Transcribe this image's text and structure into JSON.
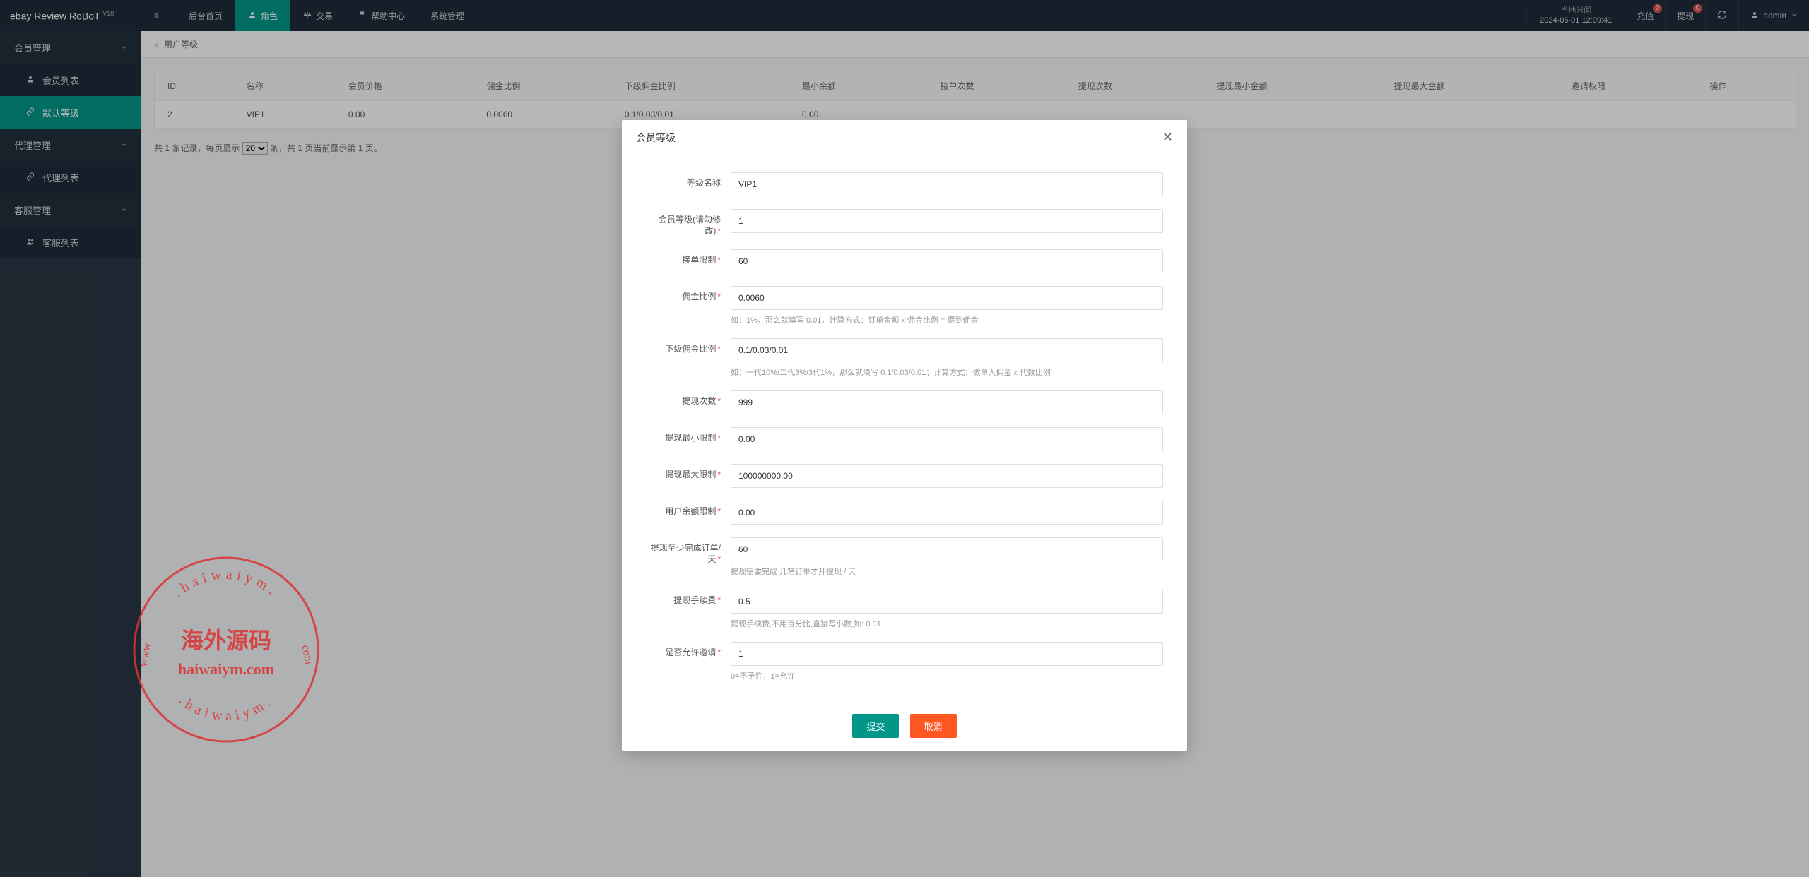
{
  "app": {
    "name": "ebay Review RoBoT",
    "version": "V18"
  },
  "top_nav": {
    "menu_icon": "≡",
    "items": [
      {
        "label": "后台首页",
        "icon": ""
      },
      {
        "label": "角色",
        "icon": "person",
        "active": true
      },
      {
        "label": "交易",
        "icon": "scale"
      },
      {
        "label": "帮助中心",
        "icon": "flag"
      },
      {
        "label": "系统管理",
        "icon": ""
      }
    ]
  },
  "header_right": {
    "time_label": "当地时间",
    "time_value": "2024-06-01 12:09:41",
    "recharge": {
      "label": "充值",
      "badge": "0"
    },
    "withdraw": {
      "label": "提现",
      "badge": "0"
    },
    "refresh_icon": "refresh",
    "user": {
      "icon": "person",
      "name": "admin",
      "caret": "chevron"
    }
  },
  "sidebar": {
    "groups": [
      {
        "label": "会员管理",
        "expanded": true,
        "items": [
          {
            "label": "会员列表",
            "icon": "person",
            "active": false
          },
          {
            "label": "默认等级",
            "icon": "link",
            "active": true
          }
        ]
      },
      {
        "label": "代理管理",
        "expanded": true,
        "items": [
          {
            "label": "代理列表",
            "icon": "link",
            "active": false
          }
        ]
      },
      {
        "label": "客服管理",
        "expanded": true,
        "items": [
          {
            "label": "客服列表",
            "icon": "people",
            "active": false
          }
        ]
      }
    ]
  },
  "breadcrumb": {
    "sep": "»",
    "current": "用户等级"
  },
  "table": {
    "headers": [
      "ID",
      "名称",
      "会员价格",
      "佣金比例",
      "下级佣金比例",
      "最小余额",
      "接单次数",
      "提现次数",
      "提现最小金额",
      "提现最大金额",
      "邀请权限",
      "操作"
    ],
    "rows": [
      {
        "id": "2",
        "name": "VIP1",
        "price": "0.00",
        "rate": "0.0060",
        "sub_rate": "0.1/0.03/0.01",
        "min_bal": "0.00"
      }
    ]
  },
  "pager": {
    "prefix": "共 1 条记录，每页显示",
    "suffix": "条，共 1 页当前显示第 1 页。",
    "page_size": "20"
  },
  "modal": {
    "title": "会员等级",
    "fields": {
      "level_name": {
        "label": "等级名称",
        "value": "VIP1",
        "required": false
      },
      "level_no": {
        "label": "会员等级(请勿修改)",
        "value": "1",
        "required": true
      },
      "order_limit": {
        "label": "接单限制",
        "value": "60",
        "required": true
      },
      "commission": {
        "label": "佣金比例",
        "value": "0.0060",
        "required": true,
        "hint": "如：1%，那么就填写 0.01，计算方式：订单金额 x 佣金比例 = 得到佣金"
      },
      "sub_commission": {
        "label": "下级佣金比例",
        "value": "0.1/0.03/0.01",
        "required": true,
        "hint": "如：一代10%/二代3%/3代1%，那么就填写 0.1/0.03/0.01；计算方式：做单人佣金 x 代数比例"
      },
      "withdraw_times": {
        "label": "提现次数",
        "value": "999",
        "required": true
      },
      "withdraw_min": {
        "label": "提现最小限制",
        "value": "0.00",
        "required": true
      },
      "withdraw_max": {
        "label": "提现最大限制",
        "value": "100000000.00",
        "required": true
      },
      "balance_limit": {
        "label": "用户余额限制",
        "value": "0.00",
        "required": true
      },
      "orders_per_day": {
        "label": "提现至少完成订单/天",
        "value": "60",
        "required": true,
        "hint": "提现需要完成 几笔订单才开提现 / 天"
      },
      "fee": {
        "label": "提现手续费",
        "value": "0.5",
        "required": true,
        "hint": "提现手续费,不用百分比,直接写小数,如: 0.01"
      },
      "allow_invite": {
        "label": "是否允许邀请",
        "value": "1",
        "required": true,
        "hint": "0=不予许，1=允许"
      }
    },
    "submit": "提交",
    "cancel": "取消"
  },
  "watermark": {
    "url_top": ".haiwaiym.",
    "url_side_r": "com",
    "url_side_l": "www",
    "center": "海外源码",
    "bottom1": "haiwaiym.com",
    "url_bottom": ".haiwaiym."
  }
}
